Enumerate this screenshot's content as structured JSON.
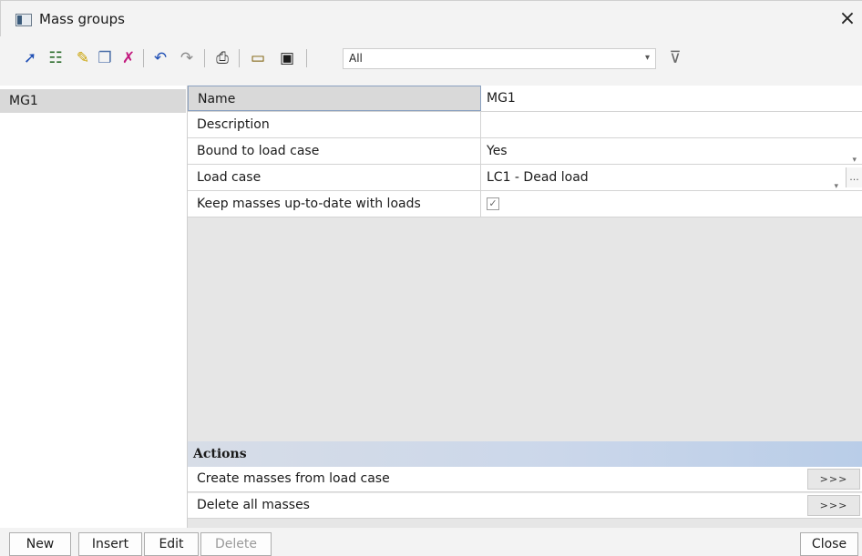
{
  "window": {
    "title": "Mass groups",
    "close_symbol": "×"
  },
  "toolbar": {
    "filter_value": "All",
    "buttons": [
      "new-item-icon",
      "columns-icon",
      "edit-icon",
      "copy-icon",
      "delete-icon",
      "undo-icon",
      "redo-icon",
      "print-icon",
      "open-icon",
      "save-icon"
    ]
  },
  "list": {
    "items": [
      "MG1"
    ]
  },
  "properties": {
    "name_label": "Name",
    "name_value": "MG1",
    "description_label": "Description",
    "description_value": "",
    "bound_label": "Bound to load case",
    "bound_value": "Yes",
    "loadcase_label": "Load case",
    "loadcase_value": "LC1 - Dead load",
    "keep_label": "Keep masses up-to-date with loads",
    "keep_checked": true,
    "ellipsis": "..."
  },
  "actions": {
    "header": "Actions",
    "items": [
      {
        "label": "Create masses from load case",
        "button": ">>>"
      },
      {
        "label": "Delete all masses",
        "button": ">>>"
      }
    ]
  },
  "footer": {
    "new": "New",
    "insert": "Insert",
    "edit": "Edit",
    "delete": "Delete",
    "close": "Close"
  }
}
